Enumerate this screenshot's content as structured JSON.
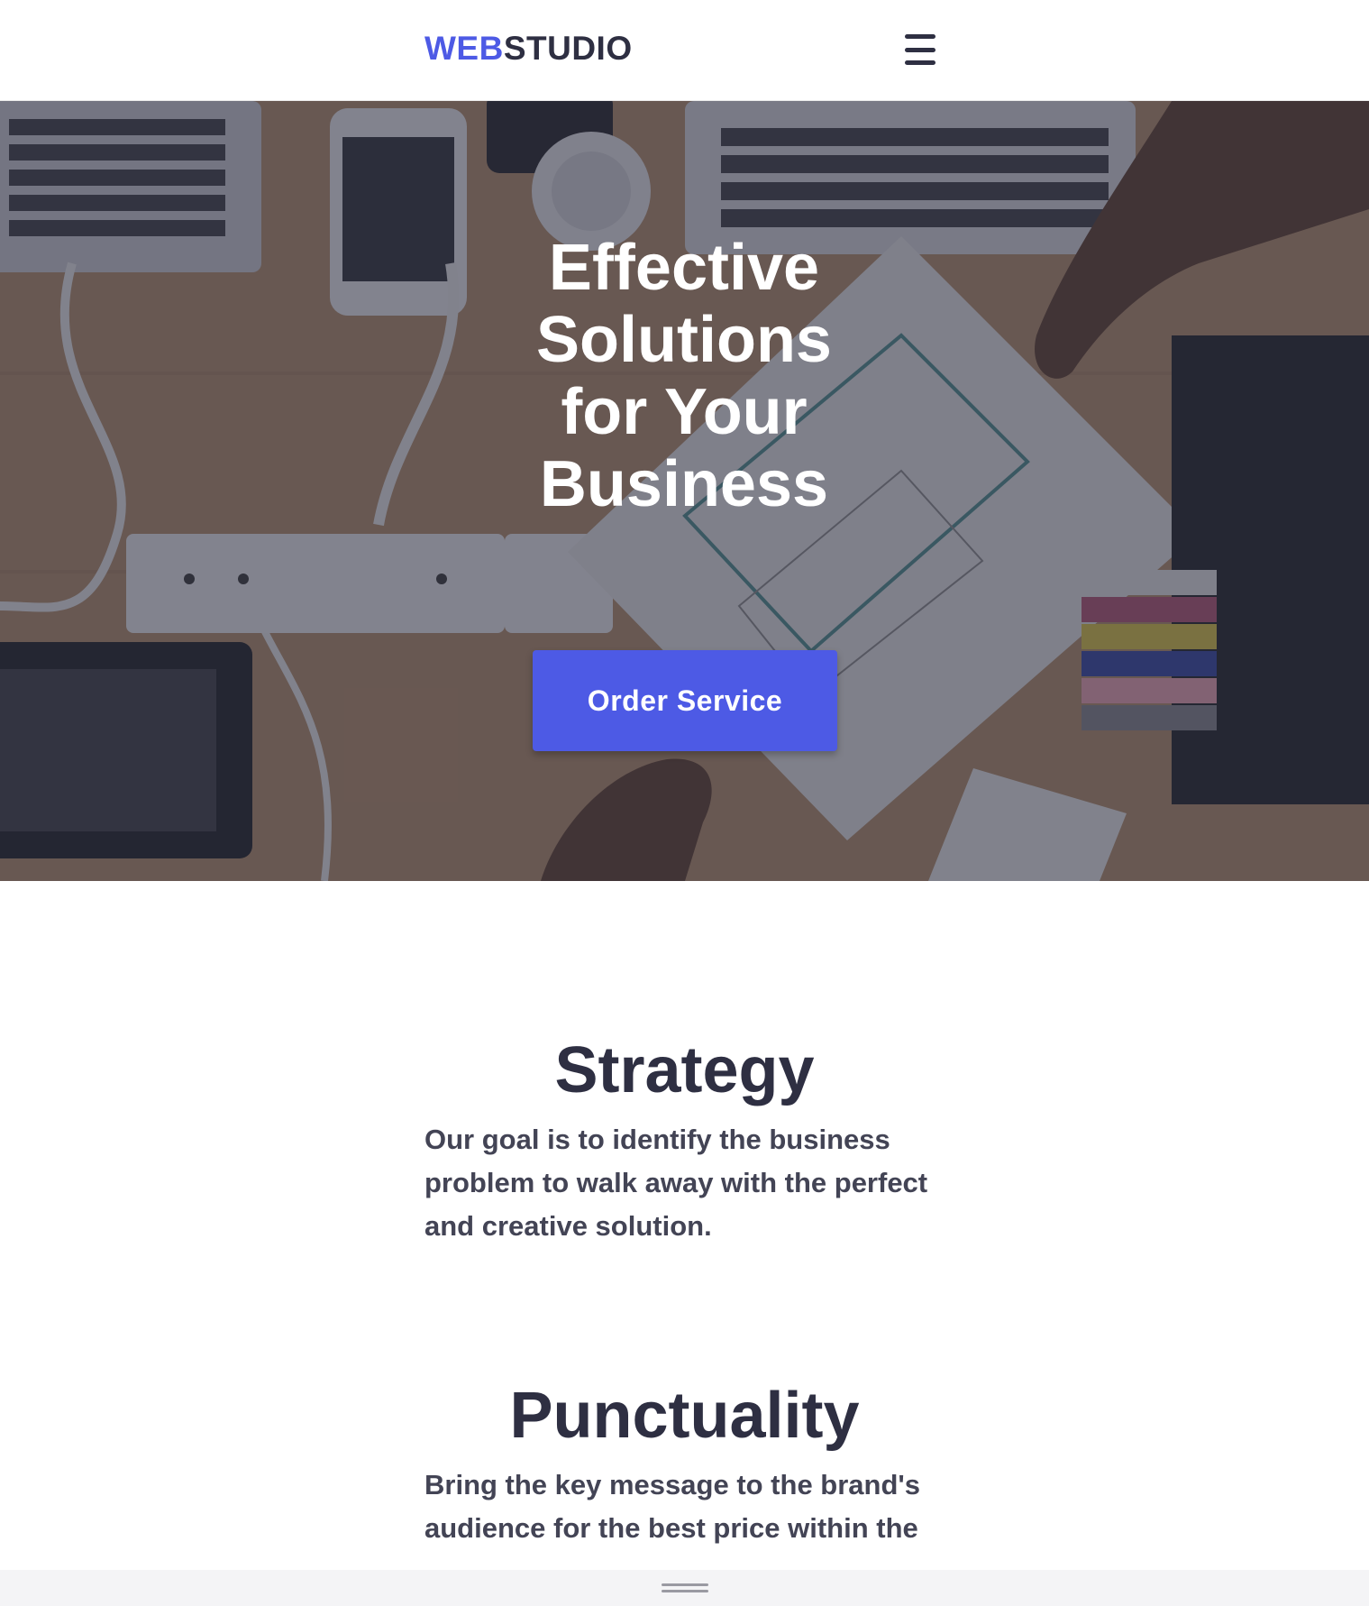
{
  "header": {
    "logo_accent": "WEB",
    "logo_rest": "STUDIO",
    "menu_icon": "hamburger-menu-icon"
  },
  "hero": {
    "title": "Effective Solutions for Your Business",
    "cta_label": "Order Service",
    "background_icon": "office-desk-photo"
  },
  "features": [
    {
      "title": "Strategy",
      "text": "Our goal is to identify the business problem to walk away with the perfect and creative solution."
    },
    {
      "title": "Punctuality",
      "text": "Bring the key message to the brand's audience for the best price within the"
    }
  ],
  "colors": {
    "accent": "#4d5ae5",
    "heading": "#2e2f42",
    "body_text": "#434455",
    "overlay": "rgba(46,47,66,0.55)"
  },
  "bottom_bar": {
    "handle_icon": "drag-handle-icon"
  }
}
